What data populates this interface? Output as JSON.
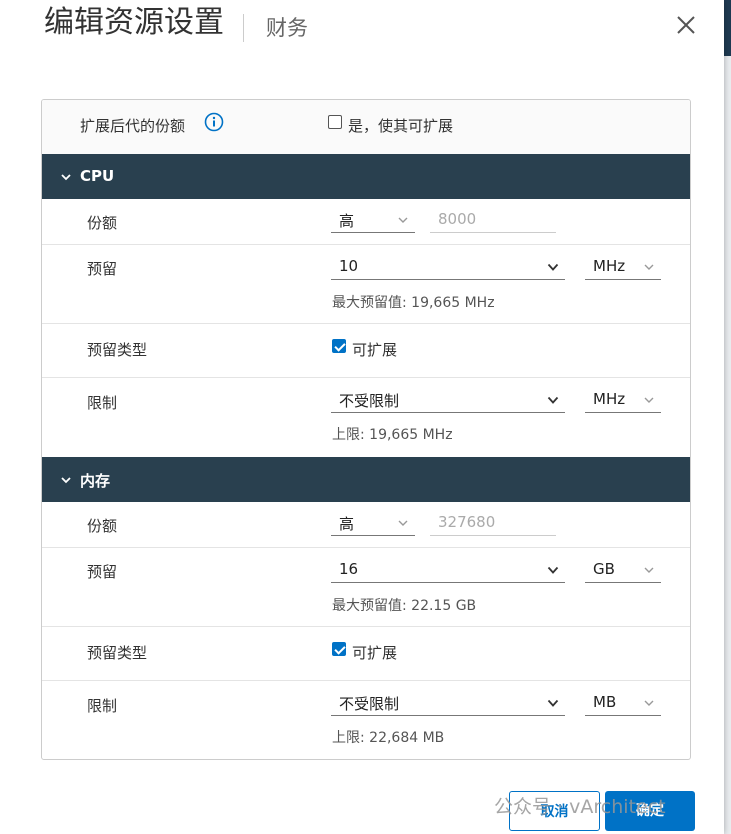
{
  "dialog": {
    "title": "编辑资源设置",
    "subtitle": "财务"
  },
  "expandable_shares": {
    "label": "扩展后代的份额",
    "checkbox_label": "是，使其可扩展",
    "checked": false
  },
  "cpu": {
    "section_title": "CPU",
    "shares": {
      "label": "份额",
      "level": "高",
      "value": "8000"
    },
    "reservation": {
      "label": "预留",
      "value": "10",
      "unit": "MHz",
      "max_hint": "最大预留值: 19,665 MHz"
    },
    "reservation_type": {
      "label": "预留类型",
      "checkbox_label": "可扩展",
      "checked": true
    },
    "limit": {
      "label": "限制",
      "value": "不受限制",
      "unit": "MHz",
      "upper_hint": "上限: 19,665 MHz"
    }
  },
  "memory": {
    "section_title": "内存",
    "shares": {
      "label": "份额",
      "level": "高",
      "value": "327680"
    },
    "reservation": {
      "label": "预留",
      "value": "16",
      "unit": "GB",
      "max_hint": "最大预留值: 22.15 GB"
    },
    "reservation_type": {
      "label": "预留类型",
      "checkbox_label": "可扩展",
      "checked": true
    },
    "limit": {
      "label": "限制",
      "value": "不受限制",
      "unit": "MB",
      "upper_hint": "上限: 22,684 MB"
    }
  },
  "footer": {
    "cancel_label": "取消",
    "ok_label": "确定"
  },
  "watermark": "公众号 · vArchitect",
  "colors": {
    "section_header_bg": "#29404f",
    "primary": "#0072c6",
    "info_icon": "#0072c6"
  }
}
